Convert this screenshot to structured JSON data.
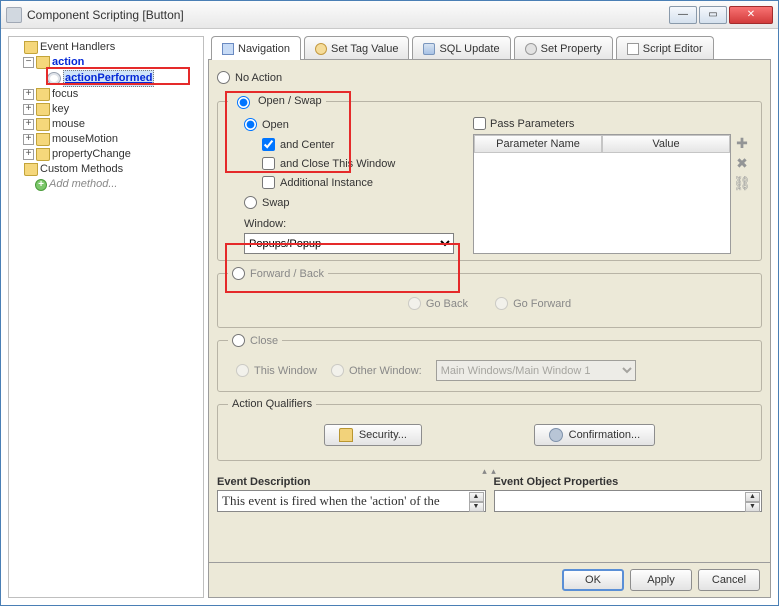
{
  "window": {
    "title": "Component Scripting [Button]"
  },
  "tree": {
    "root": "Event Handlers",
    "action": "action",
    "actionPerformed": "actionPerformed",
    "focus": "focus",
    "key": "key",
    "mouse": "mouse",
    "mouseMotion": "mouseMotion",
    "propertyChange": "propertyChange",
    "customMethods": "Custom Methods",
    "addMethod": "Add method..."
  },
  "tabs": {
    "navigation": "Navigation",
    "setTagValue": "Set Tag Value",
    "sqlUpdate": "SQL Update",
    "setProperty": "Set Property",
    "scriptEditor": "Script Editor"
  },
  "nav": {
    "noAction": "No Action",
    "openSwap": "Open / Swap",
    "open": "Open",
    "andCenter": "and Center",
    "andClose": "and Close This Window",
    "additionalInstance": "Additional Instance",
    "swap": "Swap",
    "windowLabel": "Window:",
    "windowValue": "Popups/Popup",
    "passParams": "Pass Parameters",
    "paramNameHdr": "Parameter Name",
    "paramValueHdr": "Value",
    "forwardBack": "Forward / Back",
    "goBack": "Go Back",
    "goForward": "Go Forward",
    "close": "Close",
    "thisWindow": "This Window",
    "otherWindow": "Other Window:",
    "otherWindowValue": "Main Windows/Main Window 1",
    "actionQualifiers": "Action Qualifiers",
    "security": "Security...",
    "confirmation": "Confirmation..."
  },
  "desc": {
    "eventDescLbl": "Event Description",
    "eventDesc": "This event is fired when the 'action' of the",
    "eventObjLbl": "Event Object Properties"
  },
  "buttons": {
    "ok": "OK",
    "apply": "Apply",
    "cancel": "Cancel"
  }
}
